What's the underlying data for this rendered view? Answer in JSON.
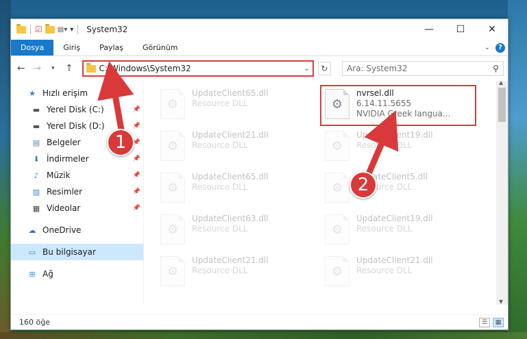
{
  "window": {
    "title": "System32"
  },
  "ribbon": {
    "tabs": [
      "Dosya",
      "Giriş",
      "Paylaş",
      "Görünüm"
    ]
  },
  "address": {
    "path": "C:\\Windows\\System32",
    "search_placeholder": "Ara: System32"
  },
  "sidebar": {
    "quick_access": "Hızlı erişim",
    "items": [
      {
        "label": "Yerel Disk (C:)",
        "icon": "drive-icon"
      },
      {
        "label": "Yerel Disk (D:)",
        "icon": "drive-icon"
      },
      {
        "label": "Belgeler",
        "icon": "documents-icon"
      },
      {
        "label": "İndirmeler",
        "icon": "download-icon"
      },
      {
        "label": "Müzik",
        "icon": "music-icon"
      },
      {
        "label": "Resimler",
        "icon": "pictures-icon"
      },
      {
        "label": "Videolar",
        "icon": "videos-icon"
      }
    ],
    "onedrive": "OneDrive",
    "this_pc": "Bu bilgisayar",
    "network": "Ağ"
  },
  "files": {
    "highlighted": {
      "name": "nvrsel.dll",
      "version": "6.14.11.5655",
      "description": "NVIDIA Greek langua..."
    },
    "left_column": [
      {
        "name": "UpdateClient65.dll",
        "type": "Resource DLL"
      },
      {
        "name": "UpdateClient21.dll",
        "type": "Resource DLL"
      },
      {
        "name": "UpdateClient65.dll",
        "type": "Resource DLL"
      },
      {
        "name": "UpdateClient63.dll",
        "type": "Resource DLL"
      },
      {
        "name": "UpdateClient21.dll",
        "type": "Resource DLL"
      }
    ],
    "right_column": [
      {
        "name": "UpdateClient19.dll",
        "type": "Resource DLL"
      },
      {
        "name": "UpdateClient5.dll",
        "type": "Resource DLL"
      },
      {
        "name": "UpdateClient19.dll",
        "type": "Resource DLL"
      },
      {
        "name": "UpdateClient21.dll",
        "type": "Resource DLL"
      }
    ]
  },
  "status": {
    "count": "160 öğe"
  },
  "annotations": {
    "step1": "1",
    "step2": "2",
    "color": "#d9393a"
  }
}
